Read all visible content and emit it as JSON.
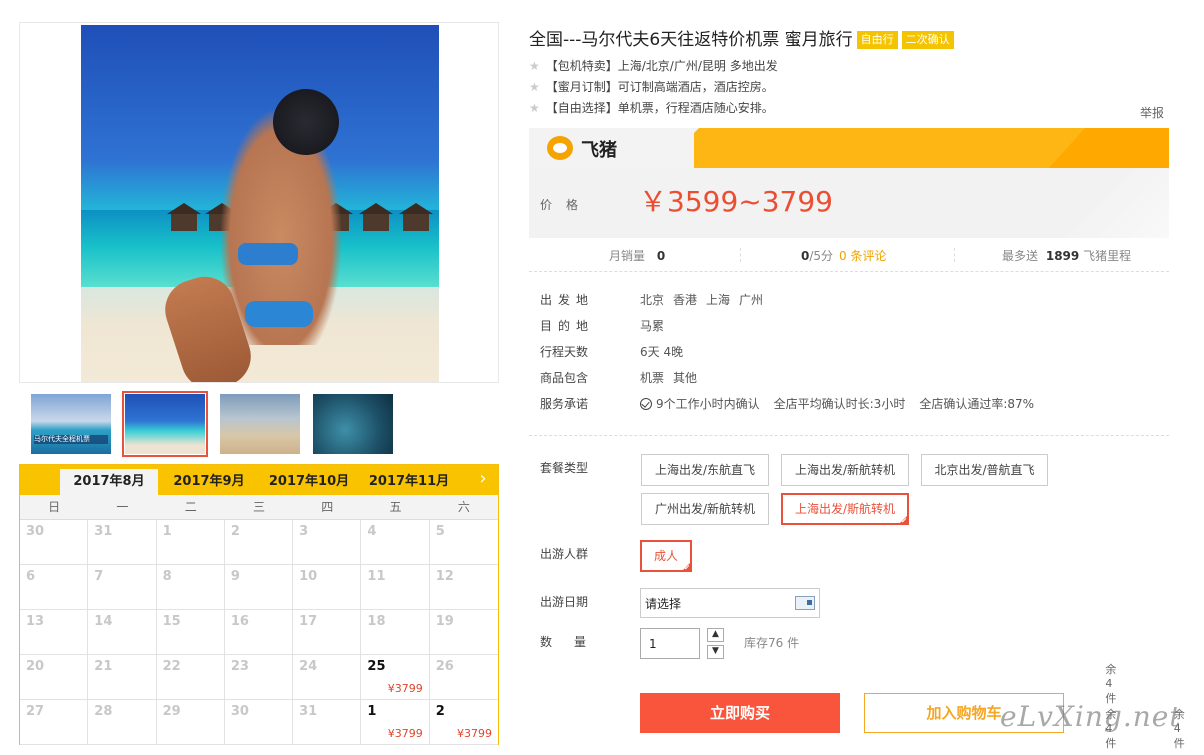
{
  "product": {
    "title": "全国---马尔代夫6天往返特价机票 蜜月旅行",
    "badges": [
      "自由行",
      "二次确认"
    ],
    "features": [
      "【包机特卖】上海/北京/广州/昆明 多地出发",
      "【蜜月订制】可订制高端酒店，酒店控房。",
      "【自由选择】单机票，行程酒店随心安排。"
    ],
    "report": "举报",
    "brand": "飞猪"
  },
  "price": {
    "label": "价格",
    "value": "￥3599~3799"
  },
  "stats": {
    "monthly_sales_label": "月销量",
    "monthly_sales": "0",
    "score": "0",
    "score_suffix": "/5分",
    "reviews": "0 条评论",
    "points_prefix": "最多送",
    "points": "1899",
    "points_suffix": "飞猪里程"
  },
  "info": [
    {
      "key": "出发地",
      "values": [
        "北京",
        "香港",
        "上海",
        "广州"
      ]
    },
    {
      "key": "目的地",
      "values": [
        "马累"
      ]
    },
    {
      "key": "行程天数",
      "values": [
        "6天 4晚"
      ]
    },
    {
      "key": "商品包含",
      "values": [
        "机票",
        "其他"
      ]
    },
    {
      "key": "服务承诺",
      "values": [
        "9个工作小时内确认",
        "全店平均确认时长:3小时",
        "全店确认通过率:87%"
      ]
    }
  ],
  "options": {
    "package_label": "套餐类型",
    "packages": [
      "上海出发/东航直飞",
      "上海出发/新航转机",
      "北京出发/普航直飞",
      "广州出发/新航转机",
      "上海出发/斯航转机"
    ],
    "selected_package": "上海出发/斯航转机",
    "crowd_label": "出游人群",
    "crowd": "成人",
    "date_label": "出游日期",
    "date_placeholder": "请选择",
    "qty_label": "数量",
    "qty_value": "1",
    "stock": "库存76 件"
  },
  "actions": {
    "buy": "立即购买",
    "cart": "加入购物车"
  },
  "calendar": {
    "months": [
      "2017年8月",
      "2017年9月",
      "2017年10月",
      "2017年11月"
    ],
    "active_month": "2017年8月",
    "weekdays": [
      "日",
      "一",
      "二",
      "三",
      "四",
      "五",
      "六"
    ],
    "days": [
      {
        "d": "30"
      },
      {
        "d": "31"
      },
      {
        "d": "1"
      },
      {
        "d": "2"
      },
      {
        "d": "3"
      },
      {
        "d": "4"
      },
      {
        "d": "5"
      },
      {
        "d": "6"
      },
      {
        "d": "7"
      },
      {
        "d": "8"
      },
      {
        "d": "9"
      },
      {
        "d": "10"
      },
      {
        "d": "11"
      },
      {
        "d": "12"
      },
      {
        "d": "13"
      },
      {
        "d": "14"
      },
      {
        "d": "15"
      },
      {
        "d": "16"
      },
      {
        "d": "17"
      },
      {
        "d": "18"
      },
      {
        "d": "19"
      },
      {
        "d": "20"
      },
      {
        "d": "21"
      },
      {
        "d": "22"
      },
      {
        "d": "23"
      },
      {
        "d": "24"
      },
      {
        "d": "25",
        "stock": "余4件",
        "price": "¥3799"
      },
      {
        "d": "26"
      },
      {
        "d": "27"
      },
      {
        "d": "28"
      },
      {
        "d": "29"
      },
      {
        "d": "30"
      },
      {
        "d": "31"
      },
      {
        "d": "1",
        "stock": "余4件",
        "price": "¥3799"
      },
      {
        "d": "2",
        "stock": "余4件",
        "price": "¥3799"
      }
    ]
  },
  "thumbnail_caption": "马尔代夫全程机票",
  "watermark": "eLvXing.net",
  "colors": {
    "accent_red": "#f8553c",
    "brand_yellow": "#fdb614",
    "badge_yellow": "#f5c400"
  }
}
